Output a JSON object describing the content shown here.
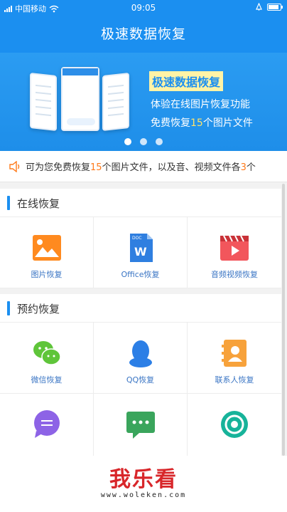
{
  "status": {
    "carrier": "中国移动",
    "time": "09:05",
    "battery_level": 0.85
  },
  "header": {
    "title": "极速数据恢复"
  },
  "banner": {
    "title": "极速数据恢复",
    "line1": "体验在线图片恢复功能",
    "line2_prefix": "免费恢复",
    "line2_number": "15",
    "line2_suffix": "个图片文件",
    "dots_count": 3,
    "active_dot": 0
  },
  "notice": {
    "prefix": "可为您免费恢复",
    "num1": "15",
    "middle": "个图片文件，以及音、视频文件各",
    "num2": "3",
    "suffix": "个"
  },
  "sections": {
    "online": {
      "title": "在线恢复",
      "items": [
        {
          "label": "图片恢复",
          "icon": "image-icon"
        },
        {
          "label": "Office恢复",
          "icon": "word-doc-icon"
        },
        {
          "label": "音频视频恢复",
          "icon": "video-icon"
        }
      ]
    },
    "scheduled": {
      "title": "预约恢复",
      "items": [
        {
          "label": "微信恢复",
          "icon": "wechat-icon"
        },
        {
          "label": "QQ恢复",
          "icon": "qq-icon"
        },
        {
          "label": "联系人恢复",
          "icon": "contacts-icon"
        },
        {
          "label": "",
          "icon": "message-bubble-icon"
        },
        {
          "label": "",
          "icon": "sms-icon"
        },
        {
          "label": "",
          "icon": "sync-icon"
        }
      ]
    }
  },
  "watermark": {
    "logo": "我乐看",
    "url": "www.woleken.com"
  },
  "colors": {
    "primary": "#1b8ff0",
    "accent_number": "#ff7a1a",
    "label": "#3a75c4"
  }
}
